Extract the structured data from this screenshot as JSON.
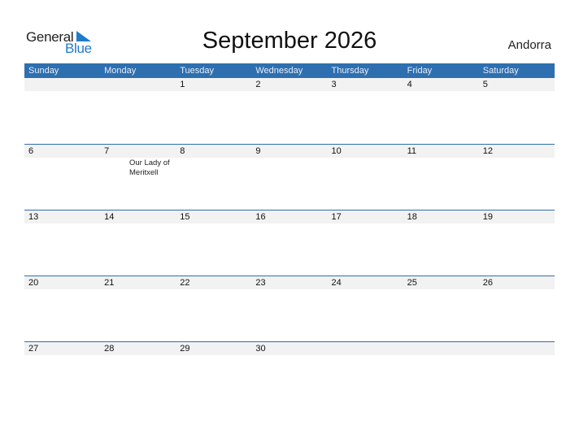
{
  "logo": {
    "line1": "General",
    "line2": "Blue",
    "accent_color": "#1f7bc9"
  },
  "title": "September 2026",
  "country": "Andorra",
  "header_color": "#2e6fb0",
  "weekdays": [
    "Sunday",
    "Monday",
    "Tuesday",
    "Wednesday",
    "Thursday",
    "Friday",
    "Saturday"
  ],
  "weeks": [
    {
      "days": [
        "",
        "",
        "1",
        "2",
        "3",
        "4",
        "5"
      ],
      "events": [
        "",
        "",
        "",
        "",
        "",
        "",
        ""
      ]
    },
    {
      "days": [
        "6",
        "7",
        "8",
        "9",
        "10",
        "11",
        "12"
      ],
      "events": [
        "",
        "",
        "Our Lady of Meritxell",
        "",
        "",
        "",
        ""
      ]
    },
    {
      "days": [
        "13",
        "14",
        "15",
        "16",
        "17",
        "18",
        "19"
      ],
      "events": [
        "",
        "",
        "",
        "",
        "",
        "",
        ""
      ]
    },
    {
      "days": [
        "20",
        "21",
        "22",
        "23",
        "24",
        "25",
        "26"
      ],
      "events": [
        "",
        "",
        "",
        "",
        "",
        "",
        ""
      ]
    },
    {
      "days": [
        "27",
        "28",
        "29",
        "30",
        "",
        "",
        ""
      ],
      "events": [
        "",
        "",
        "",
        "",
        "",
        "",
        ""
      ]
    }
  ]
}
